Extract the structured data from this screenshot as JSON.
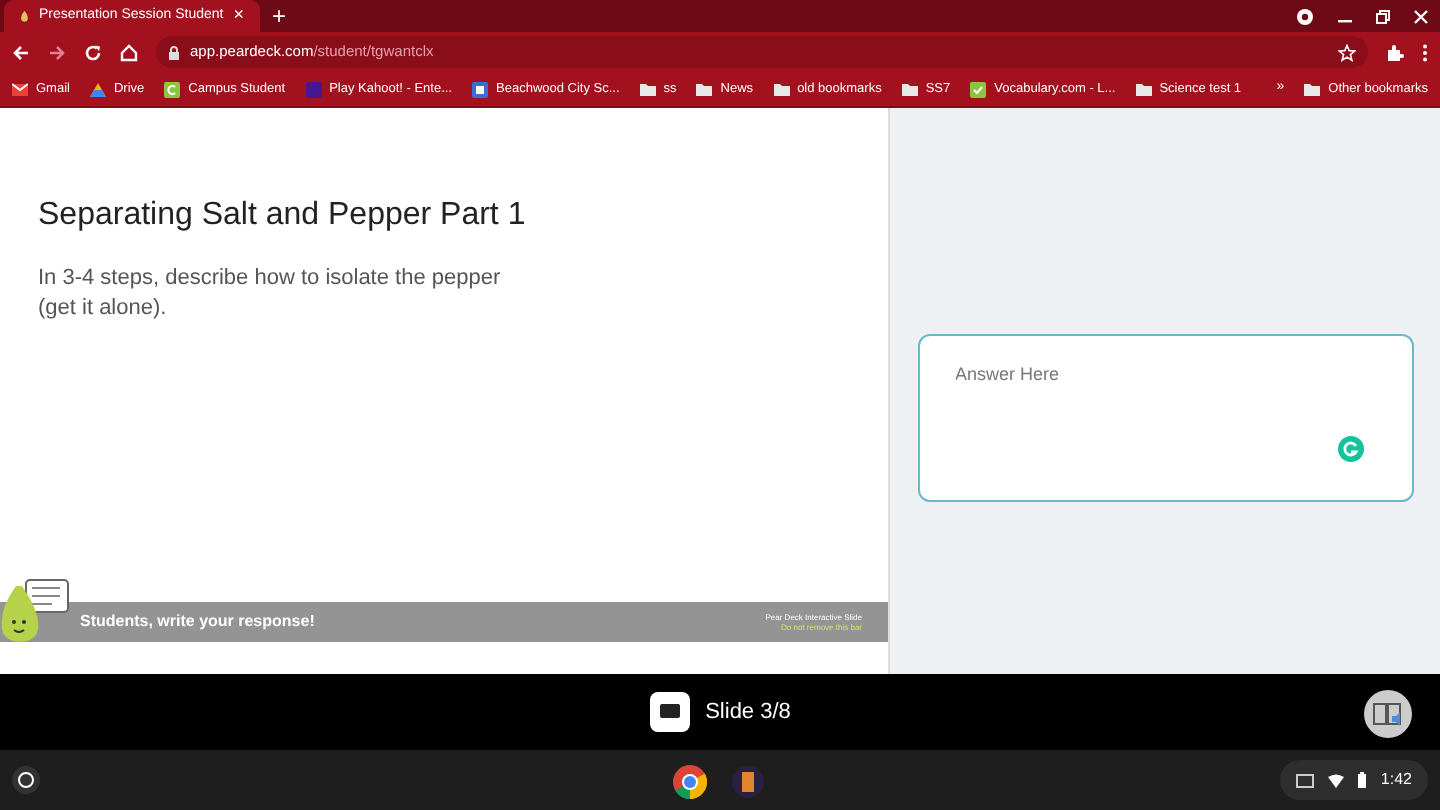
{
  "tab": {
    "title": "Presentation Session Student",
    "close": "×",
    "new": "+"
  },
  "address": {
    "host": "app.peardeck.com",
    "path": "/student/tgwantclx"
  },
  "bookmarks": [
    {
      "label": "Gmail",
      "kind": "mail"
    },
    {
      "label": "Drive",
      "kind": "drive"
    },
    {
      "label": "Campus Student",
      "kind": "campus"
    },
    {
      "label": "Play Kahoot! - Ente...",
      "kind": "kahoot"
    },
    {
      "label": "Beachwood City Sc...",
      "kind": "site"
    },
    {
      "label": "ss",
      "kind": "folder"
    },
    {
      "label": "News",
      "kind": "folder"
    },
    {
      "label": "old bookmarks",
      "kind": "folder"
    },
    {
      "label": "SS7",
      "kind": "folder"
    },
    {
      "label": "Vocabulary.com - L...",
      "kind": "vocab"
    },
    {
      "label": "Science test 1",
      "kind": "folder"
    }
  ],
  "more_bookmarks": "»",
  "other_bookmarks": "Other bookmarks",
  "slide": {
    "title": "Separating Salt and Pepper Part 1",
    "prompt": "In 3-4 steps, describe how to isolate the pepper (get it alone).",
    "banner": "Students, write your response!",
    "footer_line_1": "Pear Deck Interactive Slide",
    "footer_line_2": "Do not remove this bar"
  },
  "answer": {
    "placeholder": "Answer Here"
  },
  "slide_counter": "Slide 3/8",
  "shelf": {
    "time": "1:42"
  }
}
